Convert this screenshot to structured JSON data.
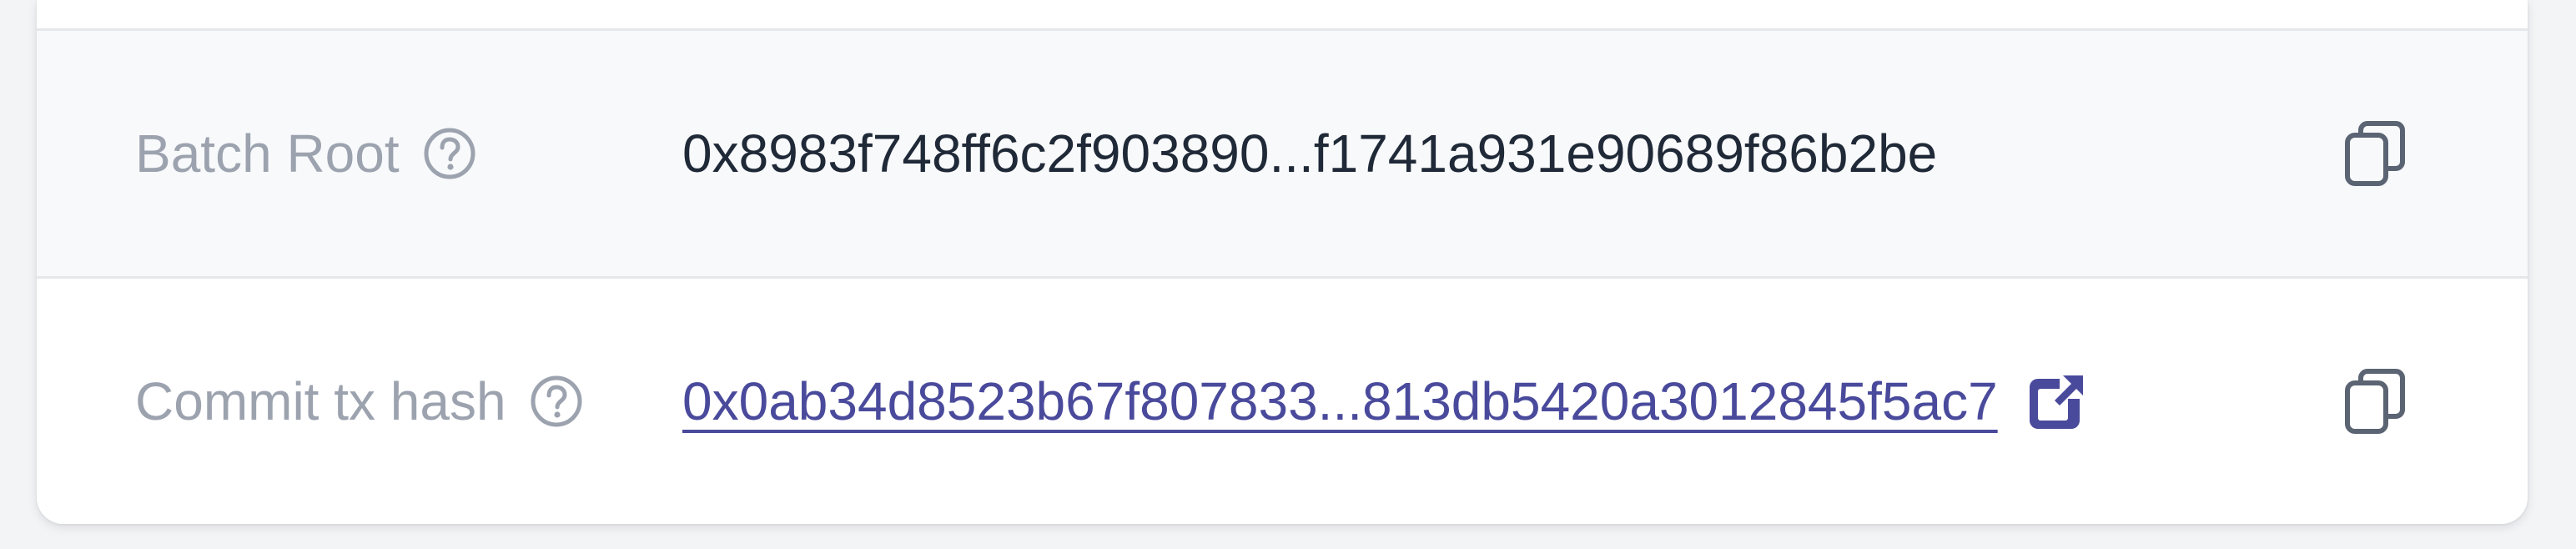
{
  "rows": [
    {
      "label": "Batch Root",
      "value": "0x8983f748ff6c2f903890...f1741a931e90689f86b2be"
    },
    {
      "label": "Commit tx hash",
      "value": "0x0ab34d8523b67f807833...813db5420a3012845f5ac7"
    }
  ],
  "icons": {
    "help": "question-circle-icon",
    "copy": "copy-icon",
    "external": "external-link-icon"
  },
  "colors": {
    "label": "#9ca3af",
    "value": "#1f2937",
    "link": "#4a4a9c",
    "icon": "#5b6473"
  }
}
